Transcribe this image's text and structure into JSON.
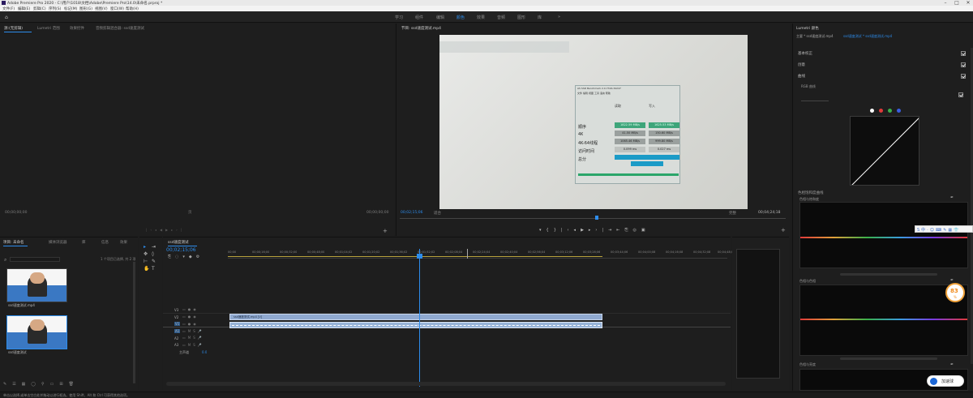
{
  "window": {
    "title": "Adobe Premiere Pro 2020 - C:\\用户\\1018\\文档\\Adobe\\Premiere Pro\\14.0\\未命名.prproj *",
    "min": "–",
    "max": "□",
    "close": "✕"
  },
  "menu": [
    "文件(F)",
    "编辑(E)",
    "剪辑(C)",
    "序列(S)",
    "标记(M)",
    "图形(G)",
    "视图(V)",
    "窗口(W)",
    "帮助(H)"
  ],
  "workspaces": [
    "学习",
    "组件",
    "编辑",
    "颜色",
    "效果",
    "音频",
    "图形",
    "库"
  ],
  "workspace_active": "颜色",
  "source_panel": {
    "tabs": [
      "源:(无剪辑)",
      "Lumetri 范围",
      "效果控件",
      "音频剪辑混合器: ssd速度测试"
    ],
    "timecode_left": "00;00;00;00",
    "timecode_right": "00;00;00;00",
    "page": "页"
  },
  "program_panel": {
    "tab": "节目: ssd速度测试.mp4",
    "timecode": "00;02;15;06",
    "fit": "适合",
    "duration": "00;04;24;18",
    "zoom": "完整"
  },
  "benchmark_window": {
    "title": "AS SSD Benchmark 2.0.7316.34247",
    "menu": [
      "文件",
      "编辑",
      "视图",
      "工具",
      "语言",
      "帮助"
    ],
    "rows": [
      {
        "label": "顺序",
        "read": "1822.59 MB/s",
        "write": "1625.53 MB/s"
      },
      {
        "label": "4K",
        "read": "41.50 MB/s",
        "write": "150.60 MB/s"
      },
      {
        "label": "4K-64线程",
        "read": "1065.46 MB/s",
        "write": "999.80 MB/s"
      },
      {
        "label": "访问时间",
        "read": "0.099 ms",
        "write": "0.027 ms"
      },
      {
        "label": "总分",
        "read": "",
        "write": ""
      }
    ],
    "headers": [
      "读取",
      "写入"
    ]
  },
  "project_panel": {
    "tabs": [
      "项目: 未命名",
      "媒体浏览器",
      "库",
      "信息",
      "效果"
    ],
    "search_placeholder": "",
    "count": "1 个项目已选择, 共 2 项",
    "items": [
      {
        "name": "ssd速度测试.mp4",
        "duration": "4:24:18"
      },
      {
        "name": "ssd速度测试",
        "duration": "4:24:18"
      }
    ]
  },
  "timeline": {
    "tab": "ssd速度测试",
    "timecode": "00;02;15;06",
    "ruler": [
      "00;00",
      "00;00;16;00",
      "00;00;32;00",
      "00;00;48;00",
      "00;01;04;02",
      "00;01;20;02",
      "00;01;36;02",
      "00;01;52;02",
      "00;02;08;04",
      "00;02;24;04",
      "00;02;40;04",
      "00;02;56;04",
      "00;03;12;06",
      "00;03;28;06",
      "00;03;44;06",
      "00;04;00;08",
      "00;04;16;08",
      "00;04;32;08",
      "00;04;48;08"
    ],
    "video_tracks": [
      "V3",
      "V2",
      "V1"
    ],
    "audio_tracks": [
      "A1",
      "A2",
      "A3"
    ],
    "master": "主声道",
    "master_value": "0.0",
    "video_clip": "ssd速度测试.mp4 [V]",
    "audio_clip": ""
  },
  "lumetri": {
    "title": "Lumetri 颜色",
    "source": "主要 * ssd速度测试.mp4",
    "sequence": "ssd速度测试 * ssd速度测试.mp4",
    "sections": [
      "基本校正",
      "创意",
      "曲线",
      "RGB 曲线",
      "色相饱和度曲线"
    ],
    "hsl_label": "色相与饱和度",
    "hsl_label2": "色相与色相",
    "hsl_label3": "色相与亮度",
    "curve_dots": [
      "#ffffff",
      "#e03a3a",
      "#3ab04a",
      "#3a5ee0"
    ]
  },
  "bottom_status": "单击以选择,或单击空白处并拖动以进行框选。使用 Shift、Alt 和 Ctrl 可获得其他选项。",
  "badge": {
    "value": "83",
    "unit": "%"
  },
  "float_button": "加速球",
  "colors": {
    "accent": "#2d8ceb",
    "bg": "#1d1d1d",
    "clip_video": "#8fa9d0"
  }
}
